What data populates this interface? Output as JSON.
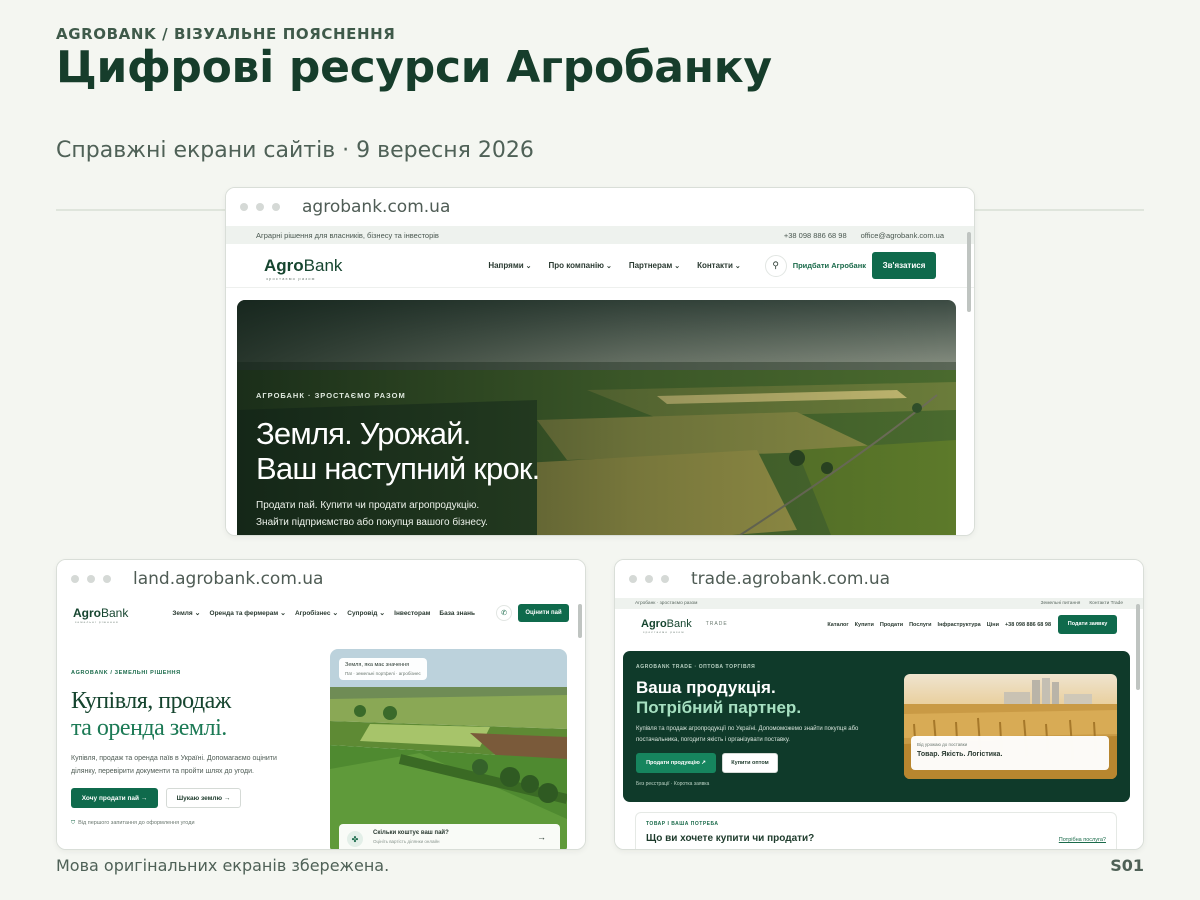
{
  "header": {
    "kicker": "AGROBANK / ВІЗУАЛЬНЕ ПОЯСНЕННЯ",
    "title": "Цифрові ресурси Агробанку",
    "subtitle": "Справжні екрани сайтів · 9 вересня 2026"
  },
  "footer": {
    "note": "Мова оригінальних екранів збережена.",
    "slide": "S01"
  },
  "main_site": {
    "url": "agrobank.com.ua",
    "util_text": "Аграрні рішення для власників, бізнесу та інвесторів",
    "phone": "+38 098 886 68 98",
    "email": "office@agrobank.com.ua",
    "logo": {
      "bold": "Agro",
      "thin": "Bank",
      "tagline": "зростаємо разом"
    },
    "nav": [
      "Напрями",
      "Про компанію",
      "Партнерам",
      "Контакти"
    ],
    "search_icon": "⚲",
    "buy_link": "Придбати Агробанк",
    "cta": "Зв'язатися",
    "hero": {
      "kicker": "АГРОБАНК · ЗРОСТАЄМО РАЗОМ",
      "h1_line1": "Земля. Урожай.",
      "h1_line2": "Ваш наступний крок.",
      "p_line1": "Продати пай. Купити чи продати агропродукцію.",
      "p_line2": "Знайти підприємство або покупця вашого бізнесу."
    }
  },
  "land_site": {
    "url": "land.agrobank.com.ua",
    "logo": {
      "bold": "Agro",
      "thin": "Bank",
      "tagline": "земельні рішення"
    },
    "nav": [
      "Земля",
      "Оренда та фермерам",
      "Агробізнес",
      "Супровід"
    ],
    "nav_plain": [
      "Інвесторам",
      "База знань"
    ],
    "phone_icon": "✆",
    "cta": "Оцінити пай",
    "kicker": "AGROBANK / ЗЕМЕЛЬНІ РІШЕННЯ",
    "h1_line1": "Купівля, продаж",
    "h1_line2": "та оренда землі.",
    "p": "Купівля, продаж та оренда паїв в Україні. Допомагаємо оцінити ділянку, перевірити документи та пройти шлях до угоди.",
    "btn_primary": "Хочу продати пай →",
    "btn_secondary": "Шукаю землю →",
    "note": "Від першого запитання до оформлення угоди",
    "shield_icon": "⛉",
    "chip_title": "Земля, яка має значення",
    "chip_sub": "Паї · земельні портфелі · агробізнес",
    "card_title": "Скільки коштує ваш пай?",
    "card_sub": "Оцініть вартість ділянки онлайн",
    "card_arrow": "→"
  },
  "trade_site": {
    "url": "trade.agrobank.com.ua",
    "util_left": "Агробанк · зростаємо разом",
    "util_right1": "Земельні питання",
    "util_right2": "Контакти Trade",
    "logo": {
      "bold": "Agro",
      "thin": "Bank",
      "tagline": "зростаємо разом",
      "sub": "TRADE"
    },
    "nav": [
      "Каталог",
      "Купити",
      "Продати",
      "Послуги",
      "Інфраструктура",
      "Ціни"
    ],
    "phone": "+38 098 886 68 98",
    "cta": "Подати заявку",
    "kicker": "AGROBANK TRADE · ОПТОВА ТОРГІВЛЯ",
    "h1_line1": "Ваша продукція.",
    "h1_line2": "Потрібний партнер.",
    "p": "Купівля та продаж агропродукції по Україні. Допомоможемо знайти покупця або постачальника, погодити якість і організувати поставку.",
    "btn_primary": "Продати продукцію ↗",
    "btn_secondary": "Купити оптом",
    "note": "Без реєстрації · Коротка заявка",
    "photo_chip_small": "Від урожаю до поставки",
    "photo_chip_big": "Товар. Якість. Логістика.",
    "card_kicker": "ТОВАР І ВАША ПОТРЕБА",
    "card_title": "Що ви хочете купити чи продати?",
    "card_link": "Потрібна послуга?"
  },
  "colors": {
    "brand": "#0f6a4c",
    "dark": "#0f3a2a",
    "title": "#163d2b"
  }
}
